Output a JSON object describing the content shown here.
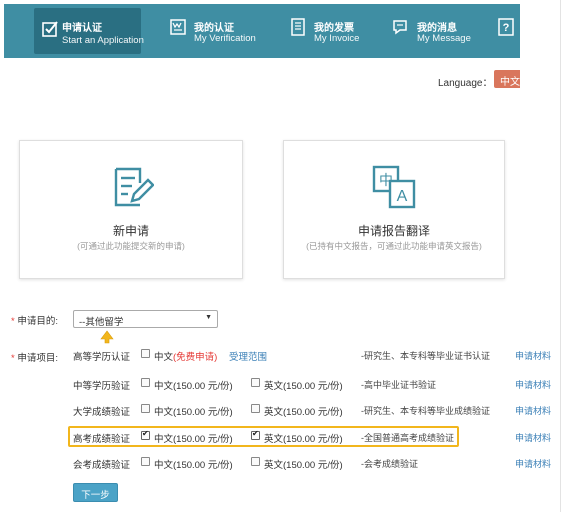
{
  "nav": {
    "items": [
      {
        "title": "申请认证",
        "subtitle": "Start an Application",
        "icon": "check-square-icon",
        "active": true
      },
      {
        "title": "我的认证",
        "subtitle": "My Verification",
        "icon": "verification-icon",
        "active": false
      },
      {
        "title": "我的发票",
        "subtitle": "My Invoice",
        "icon": "invoice-icon",
        "active": false
      },
      {
        "title": "我的消息",
        "subtitle": "My Message",
        "icon": "message-icon",
        "active": false
      },
      {
        "title": "",
        "subtitle": "",
        "icon": "help-icon",
        "active": false
      }
    ]
  },
  "language": {
    "label": "Language：",
    "current": "中文"
  },
  "cards": [
    {
      "title": "新申请",
      "subtitle": "(可通过此功能提交新的申请)",
      "icon": "edit-document-icon"
    },
    {
      "title": "申请报告翻译",
      "subtitle": "(已持有中文报告，可通过此功能申请英文报告)",
      "icon": "translate-icon"
    }
  ],
  "form": {
    "purpose_label": "申请目的:",
    "purpose_value": "--其他留学",
    "items_label": "申请项目:",
    "required_mark": "*",
    "rows": [
      {
        "name": "高等学历认证",
        "cn_label": "中文",
        "cn_extra": "(免费申请)",
        "cn_checked": false,
        "scope_link": "受理范围",
        "en_label": "",
        "en_checked": null,
        "desc": "-研究生、本专科等毕业证书认证",
        "materials": "申请材料"
      },
      {
        "name": "中等学历验证",
        "cn_label": "中文(150.00 元/份)",
        "cn_extra": "",
        "cn_checked": false,
        "scope_link": "",
        "en_label": "英文(150.00 元/份)",
        "en_checked": false,
        "desc": "-高中毕业证书验证",
        "materials": "申请材料"
      },
      {
        "name": "大学成绩验证",
        "cn_label": "中文(150.00 元/份)",
        "cn_extra": "",
        "cn_checked": false,
        "scope_link": "",
        "en_label": "英文(150.00 元/份)",
        "en_checked": false,
        "desc": "-研究生、本专科等毕业成绩验证",
        "materials": "申请材料"
      },
      {
        "name": "高考成绩验证",
        "cn_label": "中文(150.00 元/份)",
        "cn_extra": "",
        "cn_checked": true,
        "scope_link": "",
        "en_label": "英文(150.00 元/份)",
        "en_checked": true,
        "desc": "-全国普通高考成绩验证",
        "materials": "申请材料"
      },
      {
        "name": "会考成绩验证",
        "cn_label": "中文(150.00 元/份)",
        "cn_extra": "",
        "cn_checked": false,
        "scope_link": "",
        "en_label": "英文(150.00 元/份)",
        "en_checked": false,
        "desc": "-会考成绩验证",
        "materials": "申请材料"
      }
    ],
    "next_label": "下一步"
  },
  "colors": {
    "nav_bg": "#3f8ea3",
    "nav_active": "#2a6f82",
    "accent_link": "#3a7fb6",
    "required": "#e53935",
    "highlight": "#f2b61c",
    "button": "#4ba3c7",
    "lang_btn": "#d9765c"
  }
}
